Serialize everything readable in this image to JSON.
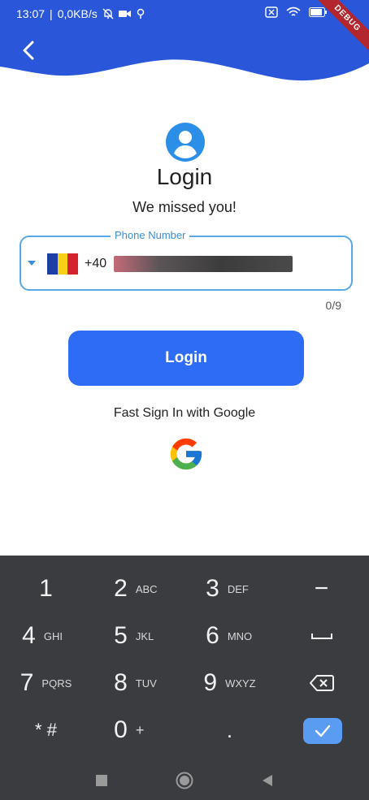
{
  "status_bar": {
    "time": "13:07",
    "speed": "0,0KB/s",
    "debug_banner": "DEBUG"
  },
  "login": {
    "title": "Login",
    "subtitle": "We missed you!",
    "phone_label": "Phone Number",
    "dial_code": "+40",
    "counter": "0/9",
    "login_button": "Login",
    "google_text": "Fast Sign In with Google"
  },
  "keyboard": {
    "rows": [
      [
        {
          "num": "1",
          "letters": ""
        },
        {
          "num": "2",
          "letters": "ABC"
        },
        {
          "num": "3",
          "letters": "DEF"
        },
        {
          "num": "−",
          "letters": ""
        }
      ],
      [
        {
          "num": "4",
          "letters": "GHI"
        },
        {
          "num": "5",
          "letters": "JKL"
        },
        {
          "num": "6",
          "letters": "MNO"
        },
        {
          "num": "␣",
          "letters": ""
        }
      ],
      [
        {
          "num": "7",
          "letters": "PQRS"
        },
        {
          "num": "8",
          "letters": "TUV"
        },
        {
          "num": "9",
          "letters": "WXYZ"
        },
        {
          "num": "⌫",
          "letters": ""
        }
      ],
      [
        {
          "num": "* #",
          "letters": ""
        },
        {
          "num": "0",
          "letters": "+"
        },
        {
          "num": ".",
          "letters": ""
        },
        {
          "num": "✓",
          "letters": ""
        }
      ]
    ]
  },
  "colors": {
    "header_blue": "#2a56d9",
    "button_blue": "#2f6cf6",
    "field_border": "#5aa8e6",
    "keyboard_bg": "#3a3c3f",
    "check_key": "#5a9cf2"
  },
  "icons": {
    "back": "chevron-left-icon",
    "avatar": "account-circle-icon",
    "google": "google-logo-icon"
  }
}
